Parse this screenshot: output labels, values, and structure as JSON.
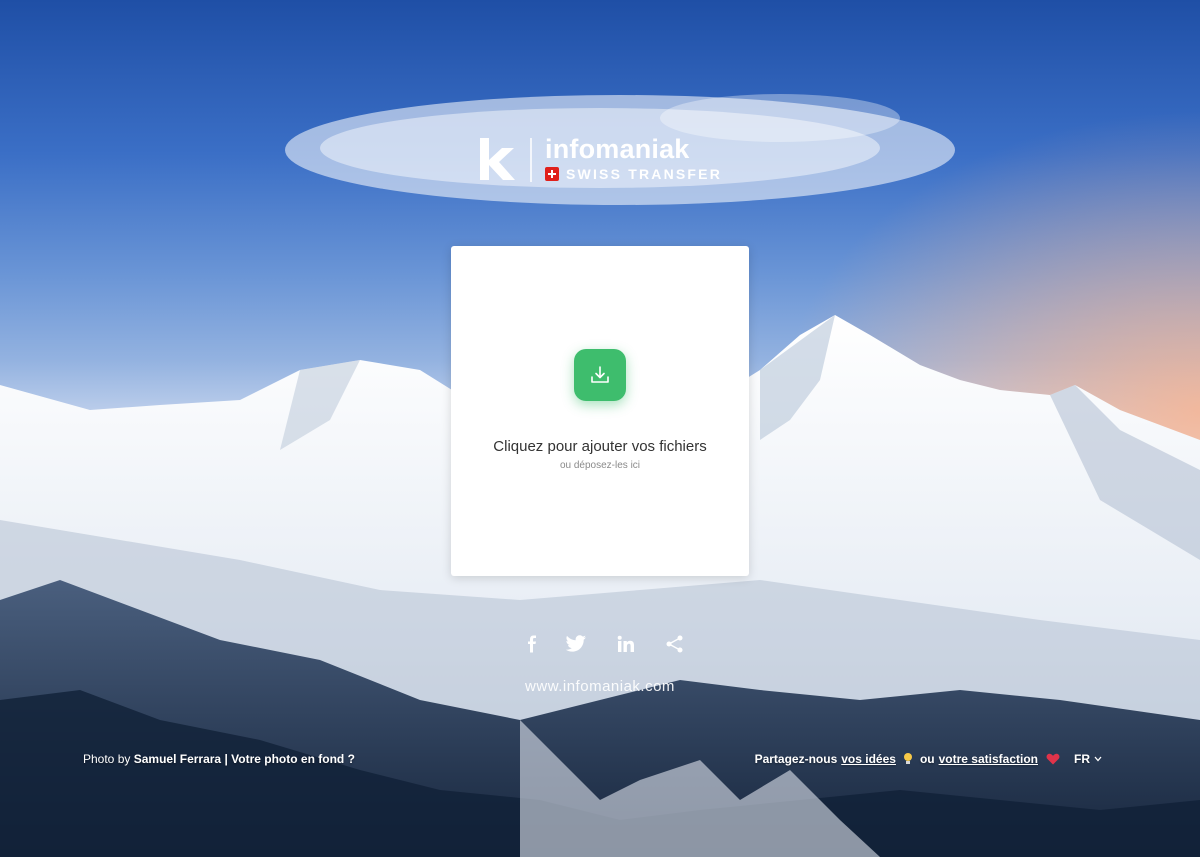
{
  "brand": {
    "name": "infomaniak",
    "product": "SWISS TRANSFER",
    "colors": {
      "accent": "#3ebd6d",
      "flag": "#e0201b"
    }
  },
  "upload": {
    "title": "Cliquez pour ajouter vos fichiers",
    "subtitle": "ou déposez-les ici",
    "icon": "download-tray-icon"
  },
  "social": {
    "icons": [
      "facebook-icon",
      "twitter-icon",
      "linkedin-icon",
      "share-icon"
    ]
  },
  "site_link": "www.infomaniak.com",
  "footer": {
    "credit_prefix": "Photo by",
    "photographer": "Samuel Ferrara",
    "separator": "|",
    "background_cta": "Votre photo en fond ?",
    "feedback_prefix": "Partagez-nous",
    "ideas_link": "vos idées",
    "or_text": "ou",
    "satisfaction_link": "votre satisfaction",
    "language": "FR"
  }
}
